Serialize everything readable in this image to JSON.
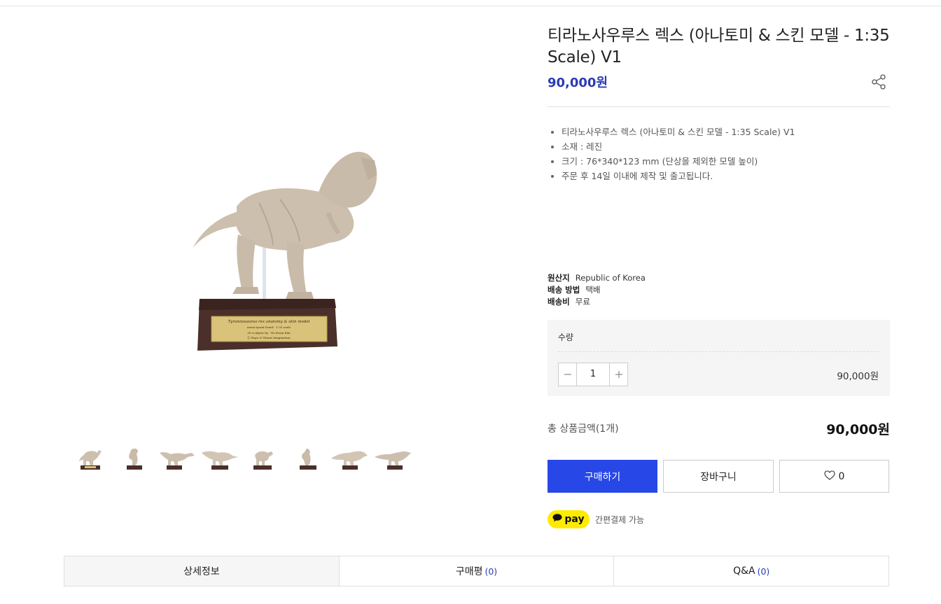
{
  "product": {
    "title": "티라노사우루스 렉스 (아나토미 & 스킨 모델 - 1:35 Scale) V1",
    "price": "90,000원",
    "plaque_lines": [
      "Tyrannosaurus rex anatomy & skin model",
      "mean tyrant lizard · 1:35 scale",
      "3D sculptor by · Ho Kwan Kim",
      "Ⓒ Ropo & Vilanis Imagination"
    ]
  },
  "description": [
    "티라노사우루스 렉스 (아나토미 & 스킨 모델 - 1:35 Scale) V1",
    "소재 : 레진",
    "크기 : 76*340*123 mm (단상을 제외한 모델 높이)",
    "주문 후 14일 이내에 제작 및 출고됩니다."
  ],
  "info": [
    {
      "key": "원산지",
      "value": "Republic of Korea"
    },
    {
      "key": "배송 방법",
      "value": "택배"
    },
    {
      "key": "배송비",
      "value": "무료"
    }
  ],
  "quantity": {
    "label": "수량",
    "value": "1",
    "line_price": "90,000원"
  },
  "total": {
    "label": "총 상품금액(1개)",
    "price": "90,000원"
  },
  "buttons": {
    "buy": "구매하기",
    "cart": "장바구니",
    "wish_count": "0"
  },
  "pay": {
    "badge": "pay",
    "text": "간편결제 가능"
  },
  "tabs": [
    {
      "label": "상세정보",
      "count": ""
    },
    {
      "label": "구매평",
      "count": "(0)"
    },
    {
      "label": "Q&A",
      "count": "(0)"
    }
  ],
  "colors": {
    "accent": "#2747e6",
    "price": "#2b3bb5",
    "pay_yellow": "#ffeb00",
    "model_beige": "#cdbfae",
    "base_wood": "#4a2f2a"
  },
  "icons": [
    "share-icon",
    "heart-icon",
    "minus-icon",
    "plus-icon",
    "speech-bubble-icon"
  ]
}
